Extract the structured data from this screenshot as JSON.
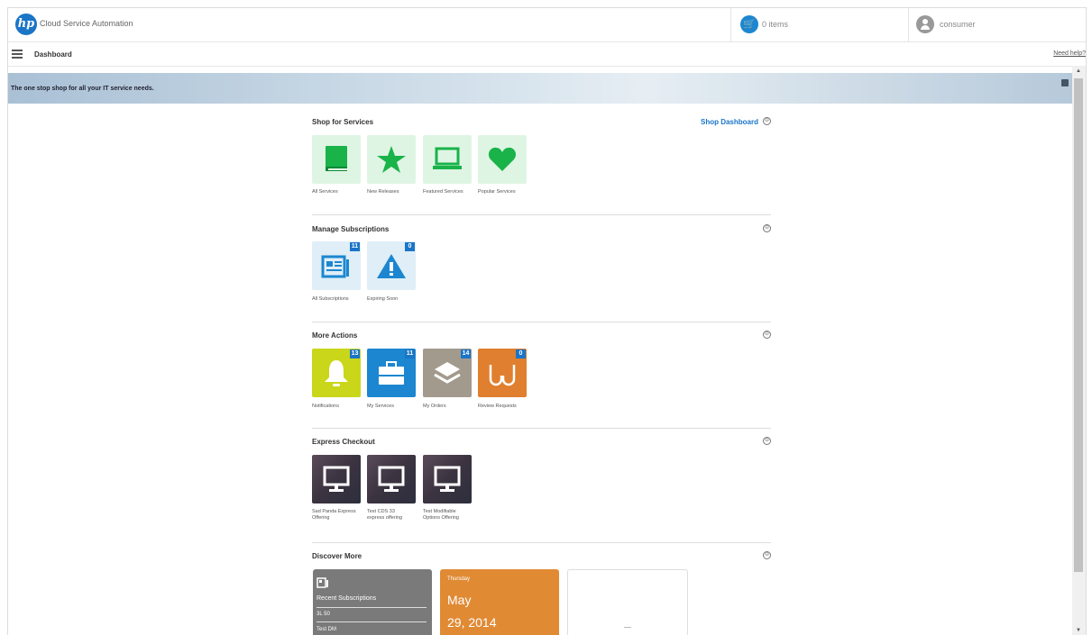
{
  "header": {
    "logo_text": "hp",
    "app_title": "Cloud Service Automation",
    "cart_label": "0 items",
    "user_label": "consumer"
  },
  "subbar": {
    "breadcrumb": "Dashboard",
    "help_label": "Need help?"
  },
  "banner": {
    "text": "The one stop shop for all your IT service needs."
  },
  "shop": {
    "title": "Shop for Services",
    "link": "Shop Dashboard",
    "tiles": [
      {
        "label": "All Services",
        "icon": "book-icon"
      },
      {
        "label": "New Releases",
        "icon": "star-icon"
      },
      {
        "label": "Featured Services",
        "icon": "laptop-icon"
      },
      {
        "label": "Popular Services",
        "icon": "heart-icon"
      }
    ]
  },
  "subscriptions": {
    "title": "Manage Subscriptions",
    "tiles": [
      {
        "label": "All Subscriptions",
        "badge": "11",
        "icon": "newspaper-icon"
      },
      {
        "label": "Expiring Soon",
        "badge": "0",
        "icon": "warning-icon"
      }
    ]
  },
  "actions": {
    "title": "More Actions",
    "tiles": [
      {
        "label": "Notifications",
        "badge": "13",
        "icon": "bell-icon",
        "color": "#c9d61a"
      },
      {
        "label": "My Services",
        "badge": "11",
        "icon": "briefcase-icon",
        "color": "#1c87d0"
      },
      {
        "label": "My Orders",
        "badge": "14",
        "icon": "layers-icon",
        "color": "#a39a8e"
      },
      {
        "label": "Review Requests",
        "badge": "0",
        "icon": "glasses-icon",
        "color": "#e07f2f"
      }
    ]
  },
  "express": {
    "title": "Express Checkout",
    "tiles": [
      {
        "label_line1": "Sad Panda Express",
        "label_line2": "Offering",
        "icon": "monitor-icon"
      },
      {
        "label_line1": "Test CDS 33",
        "label_line2": "express offering",
        "icon": "monitor-icon"
      },
      {
        "label_line1": "Test Modifiable",
        "label_line2": "Options Offering",
        "icon": "monitor-icon"
      }
    ]
  },
  "discover": {
    "title": "Discover More",
    "recent": {
      "title": "Recent Subscriptions",
      "items": [
        "3L 50",
        "Test DM"
      ]
    },
    "calendar": {
      "day": "Thursday",
      "month": "May",
      "date": "29, 2014"
    }
  },
  "colors": {
    "accent": "#1a75c7",
    "green_icon": "#19b34a",
    "calendar_orange": "#e08a34"
  }
}
